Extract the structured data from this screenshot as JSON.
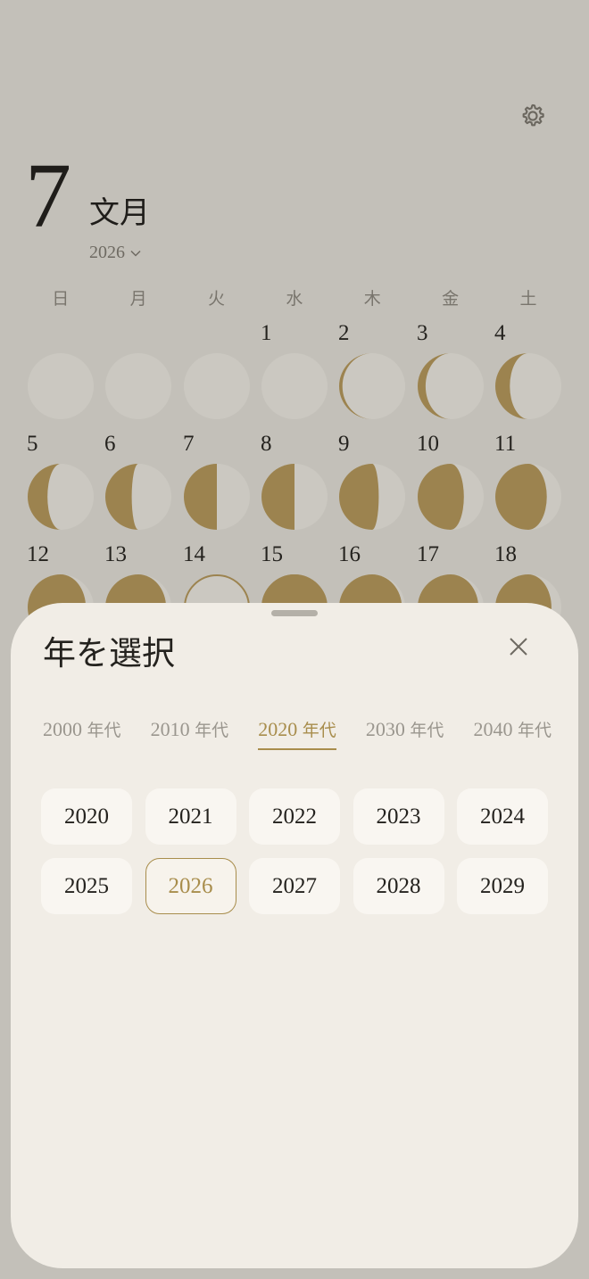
{
  "header": {
    "month_number": "7",
    "month_name": "文月",
    "year": "2026",
    "year_chevron_icon": "chevron-down-icon",
    "settings_icon": "gear-icon"
  },
  "weekdays": [
    "日",
    "月",
    "火",
    "水",
    "木",
    "金",
    "土"
  ],
  "calendar": {
    "visible_day_numbers": [
      "1",
      "2",
      "3",
      "4",
      "5",
      "6",
      "7",
      "8",
      "9",
      "10",
      "11",
      "12",
      "13",
      "14",
      "15",
      "16",
      "17",
      "18"
    ],
    "leading_empty_days": 3,
    "moon_color": "#9c834f",
    "moon_shadow_color": "#cbc8c1"
  },
  "sheet": {
    "title": "年を選択",
    "close_icon": "close-icon",
    "decade_suffix": "年代",
    "decades": [
      "2000",
      "2010",
      "2020",
      "2030",
      "2040"
    ],
    "active_decade": "2020",
    "years": [
      "2020",
      "2021",
      "2022",
      "2023",
      "2024",
      "2025",
      "2026",
      "2027",
      "2028",
      "2029"
    ],
    "selected_year": "2026",
    "accent_color": "#a88d4c"
  }
}
